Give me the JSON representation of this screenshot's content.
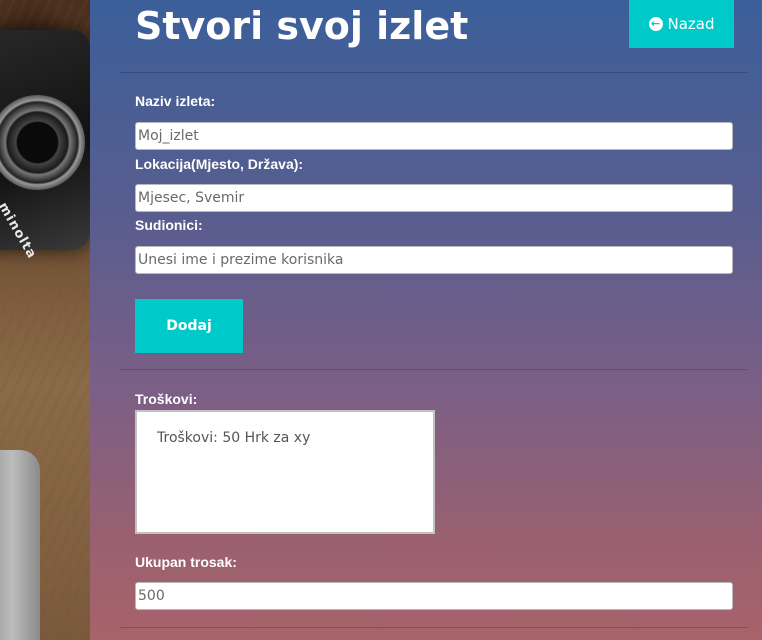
{
  "header": {
    "title": "Stvori svoj izlet",
    "back_label": "Nazad",
    "back_icon": "arrow-left-circle-icon"
  },
  "background": {
    "camera_brand": "minolta"
  },
  "form": {
    "trip_name": {
      "label": "Naziv izleta:",
      "placeholder": "Moj_izlet"
    },
    "location": {
      "label": "Lokacija(Mjesto, Država):",
      "placeholder": "Mjesec, Svemir"
    },
    "participants": {
      "label": "Sudionici:",
      "placeholder": "Unesi ime i prezime korisnika"
    },
    "add_label": "Dodaj",
    "costs": {
      "label": "Troškovi:",
      "value": "Troškovi: 50 Hrk za xy"
    },
    "total": {
      "label": "Ukupan trosak:",
      "value": "500"
    }
  },
  "colors": {
    "accent": "#00c9c9",
    "panel_top": "#3b5f9a",
    "panel_bottom": "#a8636a"
  }
}
